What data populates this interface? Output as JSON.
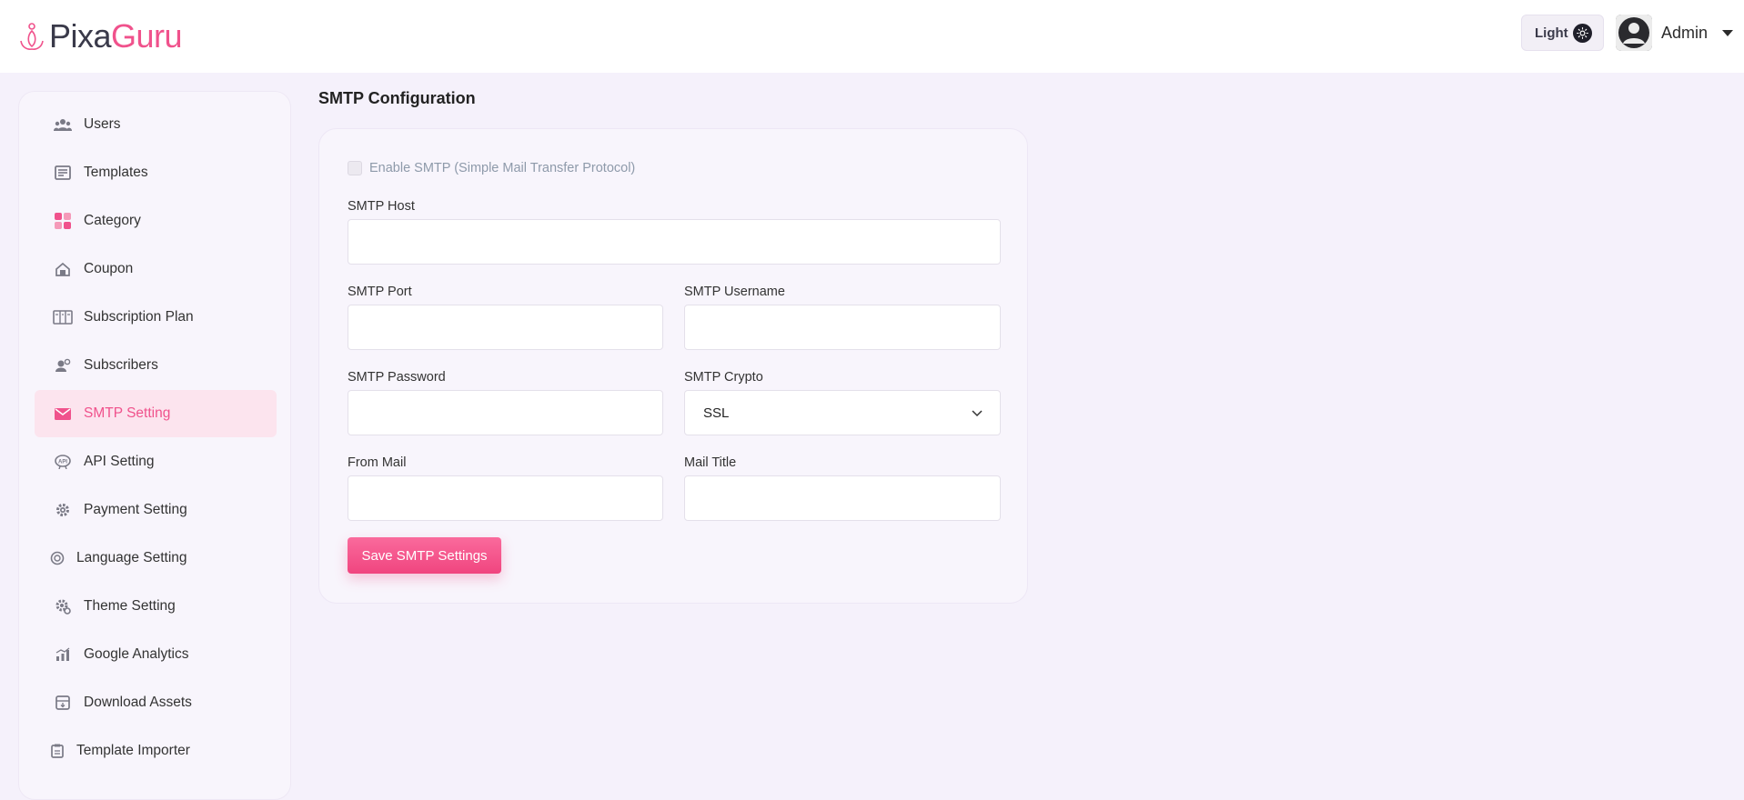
{
  "brand": {
    "name_part1": "Pixa",
    "name_part2": "Guru"
  },
  "header": {
    "theme_label": "Light",
    "theme_icon": "sun-icon",
    "user_name": "Admin",
    "user_caret_icon": "caret-down-icon"
  },
  "colors": {
    "accent": "#f0528c",
    "page_bg": "#f5f1fb",
    "active_bg": "#fce4ee"
  },
  "sidebar": {
    "items": [
      {
        "label": "Users",
        "icon": "users-icon"
      },
      {
        "label": "Templates",
        "icon": "templates-icon"
      },
      {
        "label": "Category",
        "icon": "category-icon"
      },
      {
        "label": "Coupon",
        "icon": "coupon-icon"
      },
      {
        "label": "Subscription Plan",
        "icon": "subscription-plan-icon"
      },
      {
        "label": "Subscribers",
        "icon": "subscribers-icon"
      },
      {
        "label": "SMTP Setting",
        "icon": "mail-icon",
        "active": true
      },
      {
        "label": "API Setting",
        "icon": "api-icon"
      },
      {
        "label": "Payment Setting",
        "icon": "payment-gear-icon"
      },
      {
        "label": "Language Setting",
        "icon": "language-icon"
      },
      {
        "label": "Theme Setting",
        "icon": "theme-gear-icon"
      },
      {
        "label": "Google Analytics",
        "icon": "analytics-icon"
      },
      {
        "label": "Download Assets",
        "icon": "download-icon"
      },
      {
        "label": "Template Importer",
        "icon": "importer-icon"
      }
    ]
  },
  "main": {
    "title": "SMTP Configuration",
    "enable_label": "Enable SMTP (Simple Mail Transfer Protocol)",
    "enable_checked": false,
    "fields": {
      "host": {
        "label": "SMTP Host",
        "value": ""
      },
      "port": {
        "label": "SMTP Port",
        "value": ""
      },
      "username": {
        "label": "SMTP Username",
        "value": ""
      },
      "password": {
        "label": "SMTP Password",
        "value": ""
      },
      "crypto": {
        "label": "SMTP Crypto",
        "value": "SSL"
      },
      "from_mail": {
        "label": "From Mail",
        "value": ""
      },
      "mail_title": {
        "label": "Mail Title",
        "value": ""
      }
    },
    "save_label": "Save SMTP Settings"
  }
}
